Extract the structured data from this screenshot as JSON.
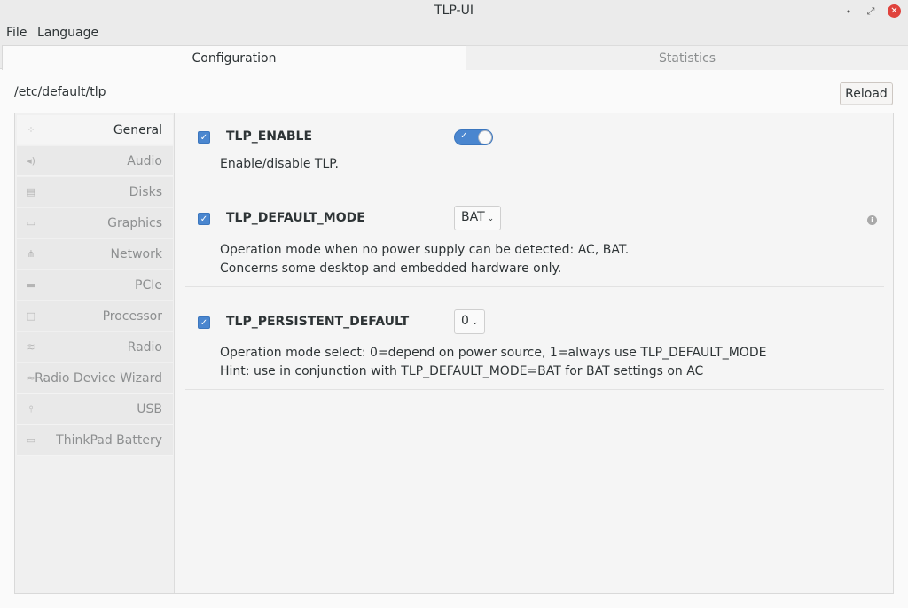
{
  "window": {
    "title": "TLP-UI",
    "controls": {
      "minimize": "•",
      "maximize": "⤢",
      "close": "✕"
    }
  },
  "menubar": {
    "file": "File",
    "language": "Language"
  },
  "tabs": {
    "configuration": "Configuration",
    "statistics": "Statistics",
    "active": "Configuration"
  },
  "path": "/etc/default/tlp",
  "reload_label": "Reload",
  "sidebar": {
    "items": [
      {
        "label": "General",
        "icon": "grid-icon",
        "active": true
      },
      {
        "label": "Audio",
        "icon": "speaker-icon"
      },
      {
        "label": "Disks",
        "icon": "disk-icon"
      },
      {
        "label": "Graphics",
        "icon": "monitor-icon"
      },
      {
        "label": "Network",
        "icon": "network-icon"
      },
      {
        "label": "PCIe",
        "icon": "pcie-icon"
      },
      {
        "label": "Processor",
        "icon": "processor-icon"
      },
      {
        "label": "Radio",
        "icon": "wifi-icon"
      },
      {
        "label": "Radio Device Wizard",
        "icon": "wizard-icon"
      },
      {
        "label": "USB",
        "icon": "usb-icon"
      },
      {
        "label": "ThinkPad Battery",
        "icon": "battery-icon"
      }
    ]
  },
  "settings": [
    {
      "name": "TLP_ENABLE",
      "enabled": true,
      "control": "toggle",
      "toggle_on": true,
      "description": [
        "Enable/disable TLP."
      ]
    },
    {
      "name": "TLP_DEFAULT_MODE",
      "enabled": true,
      "control": "combo",
      "value": "BAT",
      "has_info": true,
      "description": [
        "Operation mode when no power supply can be detected: AC, BAT.",
        "Concerns some desktop and embedded hardware only."
      ]
    },
    {
      "name": "TLP_PERSISTENT_DEFAULT",
      "enabled": true,
      "control": "combo",
      "value": "0",
      "description": [
        "Operation mode select: 0=depend on power source, 1=always use TLP_DEFAULT_MODE",
        "Hint: use in conjunction with TLP_DEFAULT_MODE=BAT for BAT settings on AC"
      ]
    }
  ],
  "colors": {
    "accent": "#4a86cf",
    "close": "#e0433d"
  }
}
